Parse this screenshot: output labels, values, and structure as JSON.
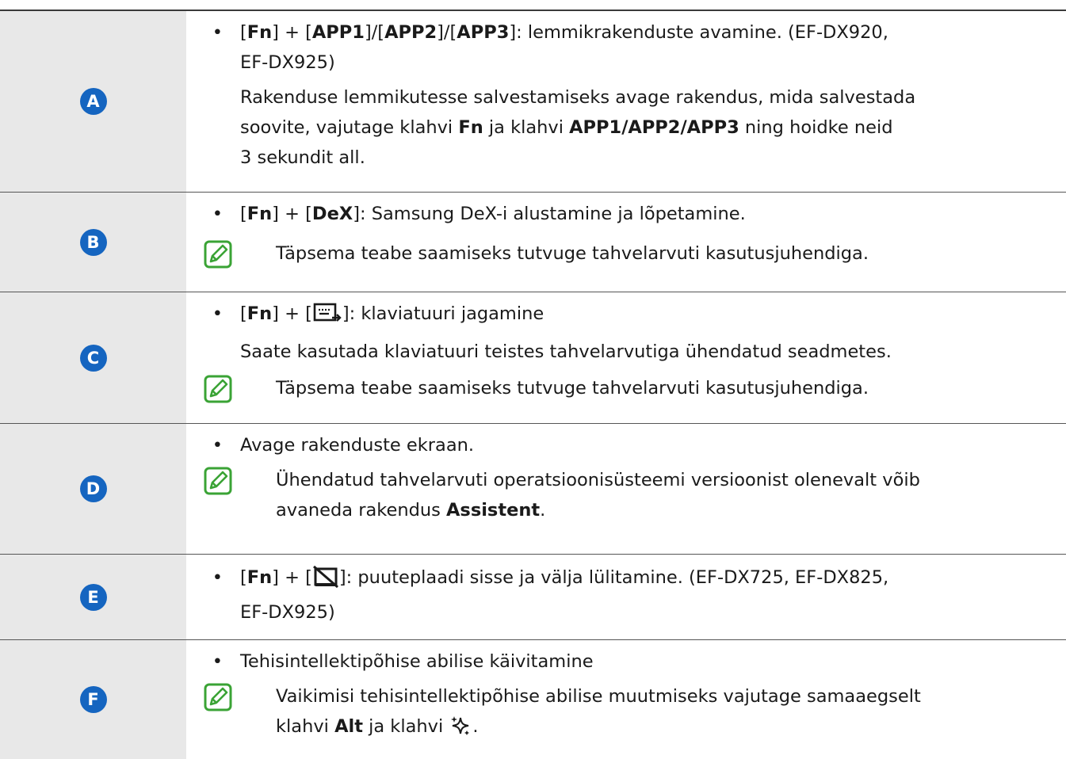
{
  "accent_color": "#1565c0",
  "note_icon_color": "#3aa335",
  "rows": {
    "a": {
      "badge": "A",
      "fn": "Fn",
      "app1": "APP1",
      "app2": "APP2",
      "app3": "APP3",
      "tail1": ": lemmikrakenduste avamine. (EF-DX920,",
      "tail2": "EF-DX925)",
      "p1": "Rakenduse lemmikutesse salvestamiseks avage rakendus, mida salvestada",
      "p2": "soovite, vajutage klahvi",
      "p2fn": "Fn",
      "p2mid": "ja klahvi",
      "p2apps": "APP1/APP2/APP3",
      "p2end": "ning hoidke neid",
      "p3": "3 sekundit all."
    },
    "b": {
      "badge": "B",
      "fn": "Fn",
      "dex": "DeX",
      "tail": ": Samsung DeX-i alustamine ja lõpetamine.",
      "note": "Täpsema teabe saamiseks tutvuge tahvelarvuti kasutusjuhendiga."
    },
    "c": {
      "badge": "C",
      "fn": "Fn",
      "tail": ": klaviatuuri jagamine",
      "p1": "Saate kasutada klaviatuuri teistes tahvelarvutiga ühendatud seadmetes.",
      "note": "Täpsema teabe saamiseks tutvuge tahvelarvuti kasutusjuhendiga."
    },
    "d": {
      "badge": "D",
      "bullet": "Avage rakenduste ekraan.",
      "note1": "Ühendatud tahvelarvuti operatsioonisüsteemi versioonist olenevalt võib",
      "note2": "avaneda rakendus",
      "note2b": "Assistent",
      "note2end": "."
    },
    "e": {
      "badge": "E",
      "fn": "Fn",
      "tail": ": puuteplaadi sisse ja välja lülitamine. (EF-DX725, EF-DX825,",
      "tail2": "EF-DX925)"
    },
    "f": {
      "badge": "F",
      "bullet": "Tehisintellektipõhise abilise käivitamine",
      "note1": "Vaikimisi tehisintellektipõhise abilise muutmiseks vajutage samaaegselt",
      "note2": "klahvi",
      "note2alt": "Alt",
      "note2mid": "ja klahvi",
      "note2end": "."
    }
  }
}
